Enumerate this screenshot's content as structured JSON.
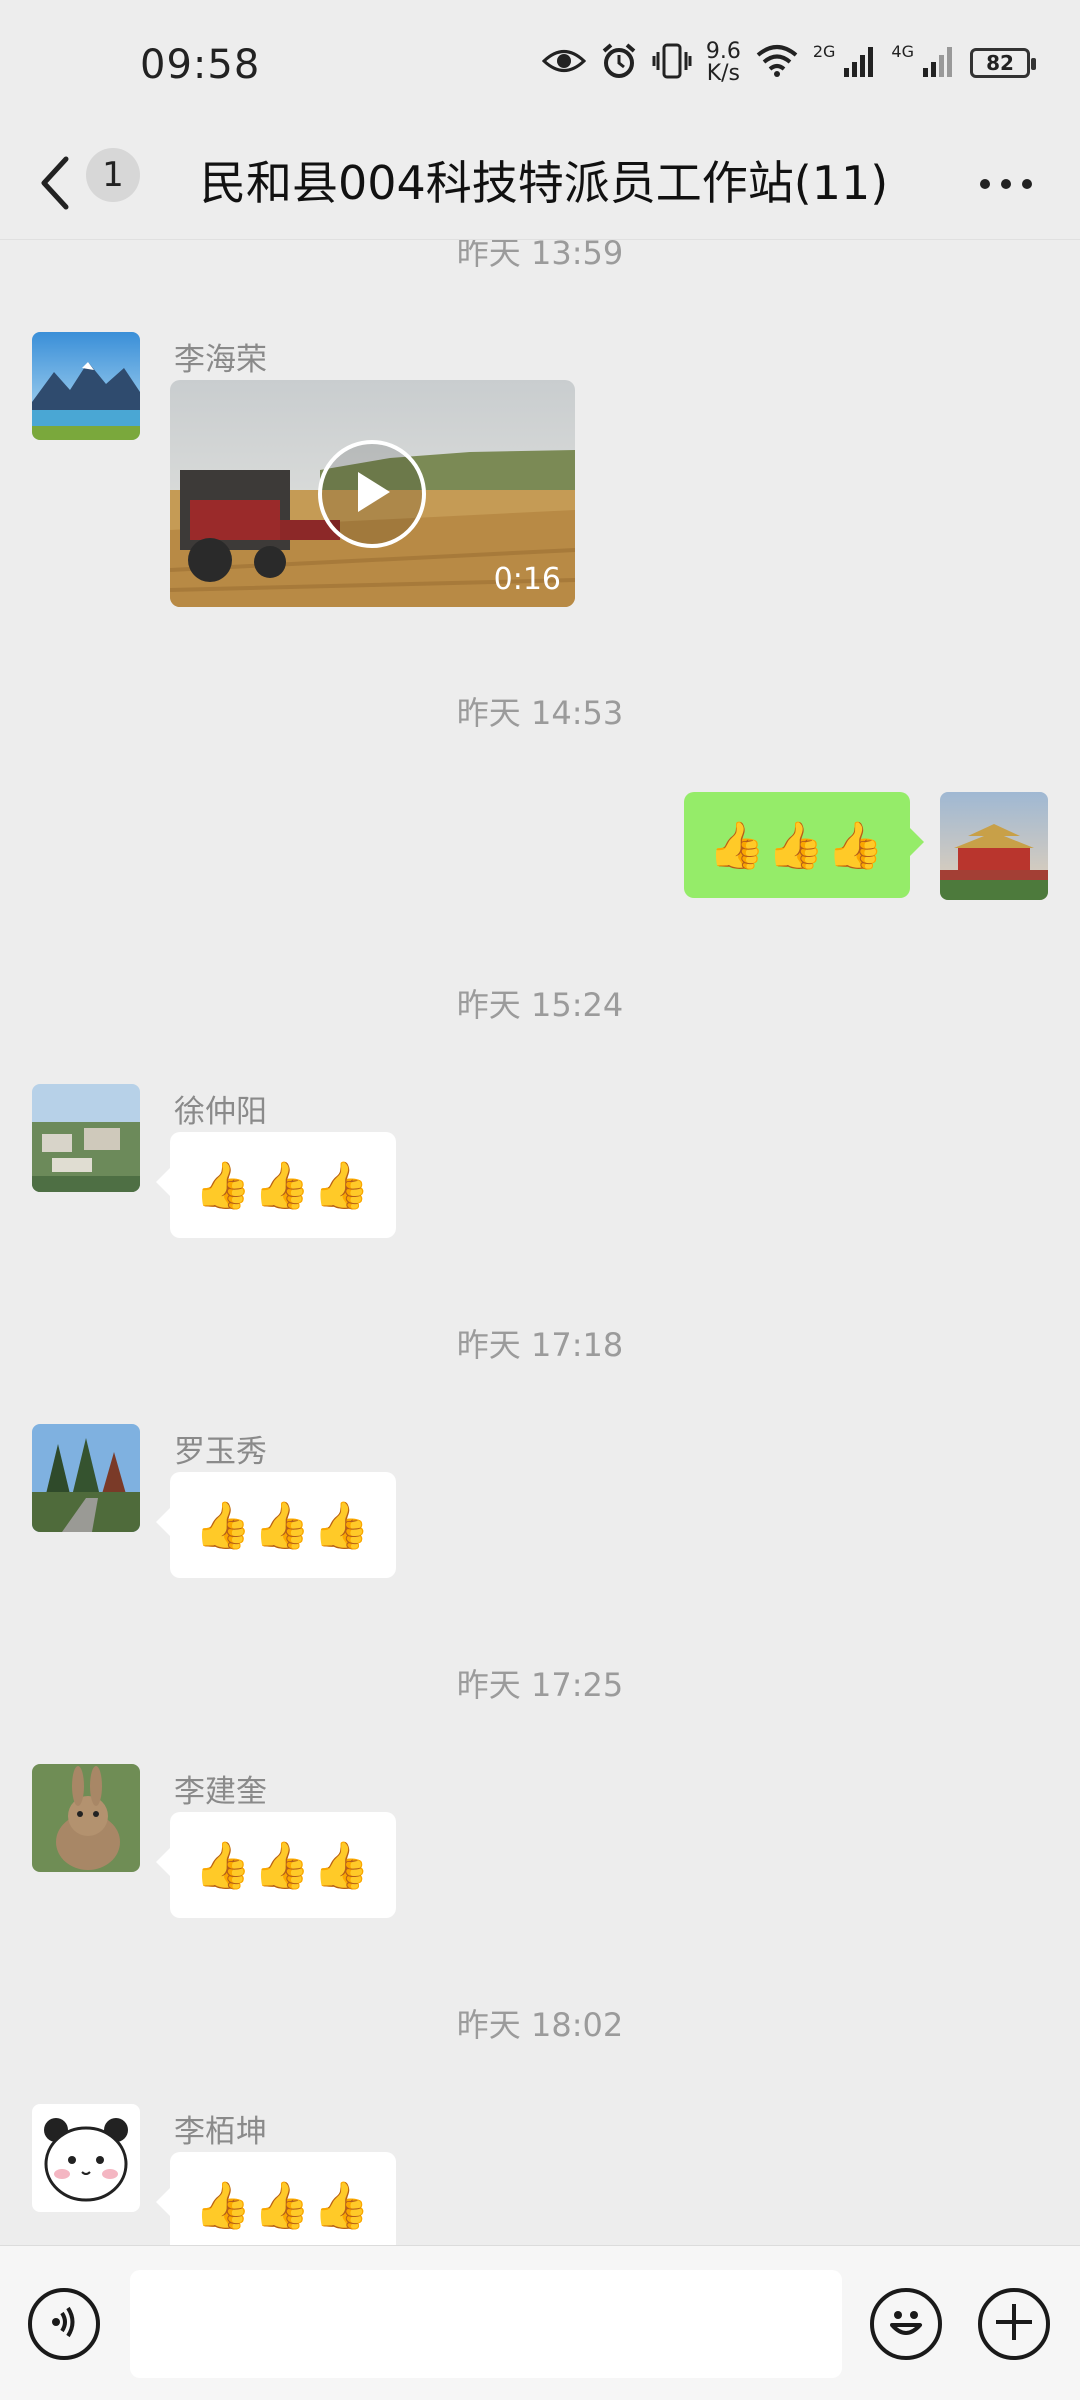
{
  "status": {
    "time": "09:58",
    "net_speed_value": "9.6",
    "net_speed_unit": "K/s",
    "net_tag_1": "2G",
    "net_tag_2": "4G",
    "battery": "82",
    "icons": [
      "eye-icon",
      "alarm-icon",
      "vibrate-icon",
      "wifi-icon",
      "signal-icon",
      "signal-icon",
      "battery-icon"
    ]
  },
  "header": {
    "back_icon": "chevron-left-icon",
    "unread_count": "1",
    "title": "民和县004科技特派员工作站(11)",
    "more_icon": "more-dots-icon"
  },
  "messages": [
    {
      "timestamp": "昨天 13:59",
      "sender": "李海荣",
      "type": "video",
      "duration": "0:16"
    },
    {
      "timestamp": "昨天 14:53",
      "sender": "",
      "type": "text",
      "text": "👍👍👍",
      "mine": true
    },
    {
      "timestamp": "昨天 15:24",
      "sender": "徐仲阳",
      "type": "text",
      "text": "👍👍👍"
    },
    {
      "timestamp": "昨天 17:18",
      "sender": "罗玉秀",
      "type": "text",
      "text": "👍👍👍"
    },
    {
      "timestamp": "昨天 17:25",
      "sender": "李建奎",
      "type": "text",
      "text": "👍👍👍"
    },
    {
      "timestamp": "昨天 18:02",
      "sender": "李栢坤",
      "type": "text",
      "text": "👍👍👍"
    }
  ],
  "input_bar": {
    "voice_icon": "voice-icon",
    "input_value": "",
    "emoji_icon": "emoji-icon",
    "plus_icon": "plus-icon"
  },
  "colors": {
    "background": "#ededed",
    "my_bubble": "#95ec69",
    "other_bubble": "#ffffff"
  }
}
